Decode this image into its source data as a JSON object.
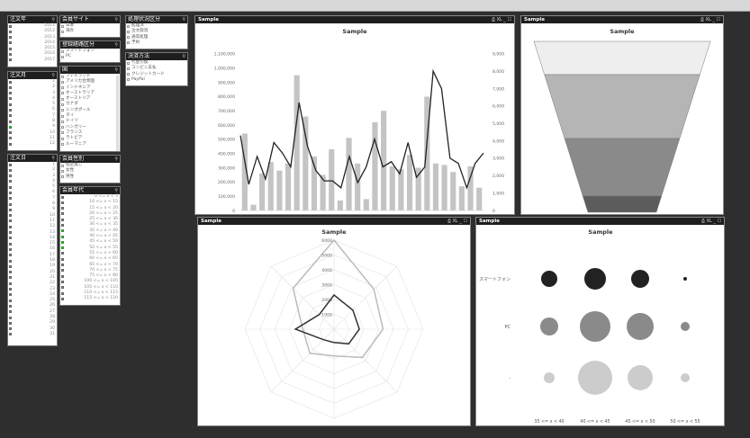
{
  "listboxes": {
    "year": {
      "title": "注文年",
      "items": [
        "2011",
        "2012",
        "2013",
        "2014",
        "2015",
        "2016",
        "2017"
      ]
    },
    "month": {
      "title": "注文月",
      "items": [
        "1",
        "2",
        "3",
        "4",
        "5",
        "6",
        "7",
        "8",
        "9",
        "10",
        "11",
        "12"
      ]
    },
    "day": {
      "title": "注文日",
      "items": [
        "1",
        "2",
        "3",
        "4",
        "5",
        "6",
        "7",
        "8",
        "9",
        "10",
        "11",
        "12",
        "13",
        "14",
        "15",
        "16",
        "17",
        "18",
        "19",
        "20",
        "21",
        "22",
        "23",
        "24",
        "25",
        "26",
        "27",
        "28",
        "29",
        "30",
        "31"
      ]
    },
    "site": {
      "title": "会員サイト",
      "items": [
        "日本",
        "海外"
      ]
    },
    "route": {
      "title": "登録経路区分",
      "items": [
        "スマートフォン",
        "PC"
      ]
    },
    "country": {
      "title": "国",
      "items": [
        "フィルランド",
        "アメリカ合衆国",
        "インドネシア",
        "オーストラリア",
        "オーストリア",
        "カナダ",
        "シンガポール",
        "タイ",
        "ドイツ",
        "ハンガリー",
        "フランス",
        "ラトビア",
        "ルーマニア"
      ]
    },
    "gender": {
      "title": "会員性別",
      "items": [
        "指定無し",
        "女性",
        "男性"
      ]
    },
    "age": {
      "title": "会員年代",
      "items": [
        "0 <= x < 5",
        "10 <= x < 15",
        "15 <= x < 20",
        "20 <= x < 25",
        "25 <= x < 30",
        "30 <= x < 35",
        "35 <= x < 40",
        "40 <= x < 45",
        "45 <= x < 50",
        "50 <= x < 55",
        "55 <= x < 60",
        "60 <= x < 65",
        "65 <= x < 70",
        "70 <= x < 75",
        "75 <= x < 80",
        "100 <= x < 105",
        "105 <= x < 110",
        "110 <= x < 115",
        "115 <= x < 120"
      ]
    },
    "status": {
      "title": "処理状況区分",
      "items": [
        "処理済",
        "注文取消",
        "通常処理",
        "予約"
      ]
    },
    "payment": {
      "title": "決済方法",
      "items": [
        "代金引換",
        "コンビニ支払",
        "クレジットカード",
        "PayPal"
      ]
    }
  },
  "panels": {
    "combo": {
      "header": "Sample",
      "title": "Sample",
      "controls": "⎙ XL _ ☐"
    },
    "funnel": {
      "header": "Sample",
      "title": "Sample",
      "controls": "⎙ XL _ ☐"
    },
    "radar": {
      "header": "Sample",
      "title": "Sample",
      "controls": "⎙ XL _ ☐"
    },
    "bubble": {
      "header": "Sample",
      "title": "Sample",
      "controls": "⎙ XL _ ☐"
    }
  },
  "chart_data": [
    {
      "type": "bar",
      "title": "Sample",
      "left_axis": {
        "ticks": [
          "0",
          "100,000",
          "200,000",
          "300,000",
          "400,000",
          "500,000",
          "600,000",
          "700,000",
          "800,000",
          "900,000",
          "1,000,000",
          "1,100,000"
        ],
        "ylim": [
          0,
          1150000
        ]
      },
      "right_axis": {
        "ticks": [
          "0",
          "1,000",
          "2,000",
          "3,000",
          "4,000",
          "5,000",
          "6,000",
          "7,000",
          "8,000",
          "9,000"
        ],
        "ylim": [
          0,
          9400
        ]
      },
      "bars": [
        540000,
        40000,
        260000,
        340000,
        280000,
        330000,
        950000,
        660000,
        380000,
        250000,
        430000,
        70000,
        510000,
        330000,
        80000,
        620000,
        700000,
        310000,
        290000,
        390000,
        300000,
        800000,
        330000,
        320000,
        270000,
        170000,
        310000,
        160000
      ],
      "line": [
        4300,
        1500,
        3100,
        1800,
        3900,
        3300,
        2500,
        6200,
        3700,
        2300,
        1700,
        1700,
        1300,
        3100,
        1600,
        2500,
        4100,
        2500,
        2800,
        2100,
        3900,
        1900,
        2500,
        8000,
        7000,
        3000,
        2700,
        1300,
        2700,
        3300
      ]
    },
    {
      "type": "area",
      "title": "Sample",
      "subtype": "funnel",
      "levels": 4,
      "colors": [
        "#eeeeee",
        "#b5b5b5",
        "#8a8a8a",
        "#5c5c5c"
      ]
    },
    {
      "type": "line",
      "title": "Sample",
      "subtype": "radar",
      "ticks": [
        "1000",
        "2000",
        "3000",
        "4000",
        "5000",
        "6000"
      ],
      "rmax": 6000,
      "axes_count": 8,
      "series": [
        {
          "color": "#bbbbbb",
          "values": [
            6000,
            3800,
            3300,
            2700,
            1800,
            2300,
            2100,
            3900
          ]
        },
        {
          "color": "#333333",
          "values": [
            2300,
            1800,
            1700,
            1400,
            900,
            1000,
            2600,
            1400
          ]
        }
      ]
    },
    {
      "type": "scatter",
      "title": "Sample",
      "subtype": "bubble",
      "categories": [
        "35 <= x < 40",
        "40 <= x < 45",
        "45 <= x < 50",
        "50 <= x < 55"
      ],
      "rows": [
        {
          "label": "スマートフォン",
          "color": "#222222",
          "sizes": [
            9,
            12,
            10,
            2
          ]
        },
        {
          "label": "PC",
          "color": "#8a8a8a",
          "sizes": [
            10,
            17,
            15,
            5
          ]
        },
        {
          "label": "-",
          "color": "#cccccc",
          "sizes": [
            6,
            19,
            14,
            5
          ]
        }
      ]
    }
  ]
}
